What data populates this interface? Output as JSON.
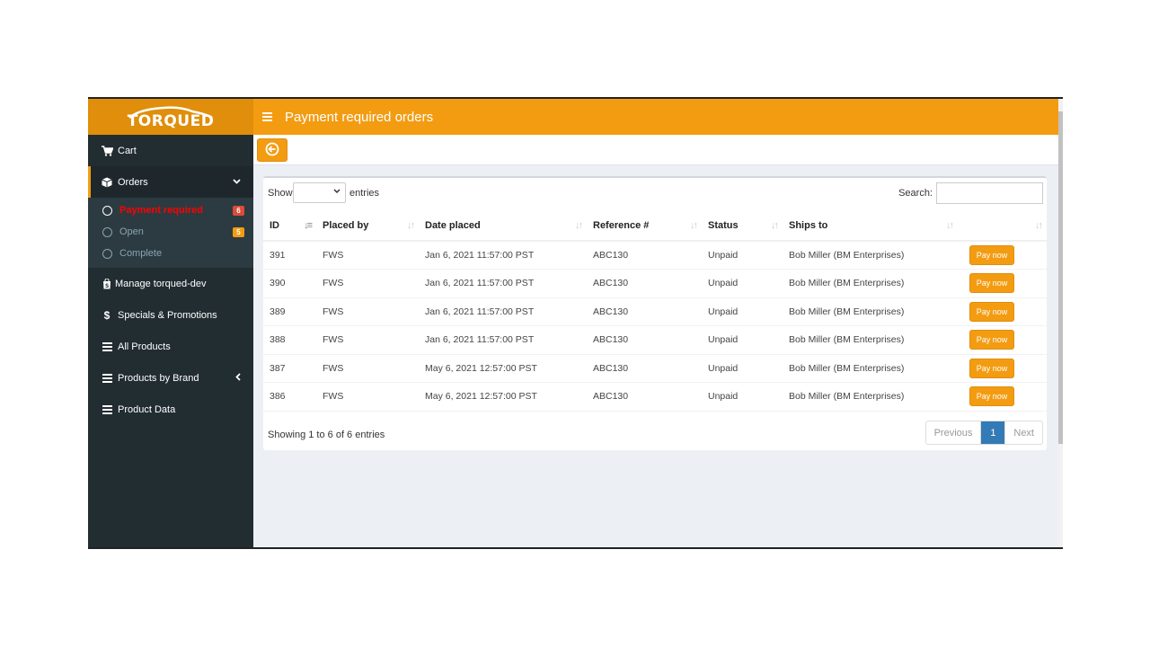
{
  "brand": {
    "name": "TORQUED",
    "accent": "#f39c12",
    "accent_dark": "#e08e0b",
    "sidebar_bg": "#222d32"
  },
  "header": {
    "title": "Payment required orders"
  },
  "sidebar": {
    "items": [
      {
        "label": "Cart",
        "icon": "cart-icon"
      },
      {
        "label": "Orders",
        "icon": "cube-icon",
        "expanded": true,
        "children": [
          {
            "label": "Payment required",
            "badge": "6",
            "badge_color": "#dd4b39",
            "current": true
          },
          {
            "label": "Open",
            "badge": "5",
            "badge_color": "#f39c12"
          },
          {
            "label": "Complete"
          }
        ]
      },
      {
        "label": "Manage torqued-dev",
        "icon": "shopify-bag-icon"
      },
      {
        "label": "Specials & Promotions",
        "icon": "dollar-icon"
      },
      {
        "label": "All Products",
        "icon": "list-icon"
      },
      {
        "label": "Products by Brand",
        "icon": "list-icon",
        "has_submenu": true
      },
      {
        "label": "Product Data",
        "icon": "list-icon"
      }
    ]
  },
  "table": {
    "show_label": "Show",
    "entries_label": "entries",
    "length_value": "",
    "search_label": "Search:",
    "search_value": "",
    "columns": [
      "ID",
      "Placed by",
      "Date placed",
      "Reference #",
      "Status",
      "Ships to",
      ""
    ],
    "sorted_column": "ID",
    "rows": [
      {
        "id": "391",
        "placed_by": "FWS",
        "date": "Jan 6, 2021 11:57:00 PST",
        "ref": "ABC130",
        "status": "Unpaid",
        "ships_to": "Bob Miller (BM Enterprises)",
        "action": "Pay now"
      },
      {
        "id": "390",
        "placed_by": "FWS",
        "date": "Jan 6, 2021 11:57:00 PST",
        "ref": "ABC130",
        "status": "Unpaid",
        "ships_to": "Bob Miller (BM Enterprises)",
        "action": "Pay now"
      },
      {
        "id": "389",
        "placed_by": "FWS",
        "date": "Jan 6, 2021 11:57:00 PST",
        "ref": "ABC130",
        "status": "Unpaid",
        "ships_to": "Bob Miller (BM Enterprises)",
        "action": "Pay now"
      },
      {
        "id": "388",
        "placed_by": "FWS",
        "date": "Jan 6, 2021 11:57:00 PST",
        "ref": "ABC130",
        "status": "Unpaid",
        "ships_to": "Bob Miller (BM Enterprises)",
        "action": "Pay now"
      },
      {
        "id": "387",
        "placed_by": "FWS",
        "date": "May 6, 2021 12:57:00 PST",
        "ref": "ABC130",
        "status": "Unpaid",
        "ships_to": "Bob Miller (BM Enterprises)",
        "action": "Pay now"
      },
      {
        "id": "386",
        "placed_by": "FWS",
        "date": "May 6, 2021 12:57:00 PST",
        "ref": "ABC130",
        "status": "Unpaid",
        "ships_to": "Bob Miller (BM Enterprises)",
        "action": "Pay now"
      }
    ],
    "info": "Showing 1 to 6 of 6 entries",
    "pagination": {
      "previous": "Previous",
      "current": "1",
      "next": "Next"
    }
  }
}
